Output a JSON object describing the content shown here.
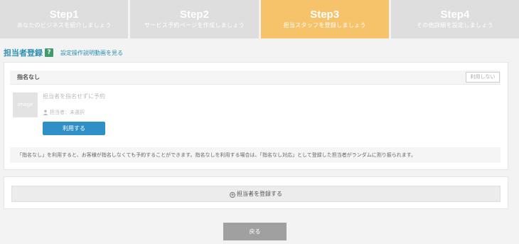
{
  "steps": [
    {
      "title": "Step1",
      "subtitle": "あなたのビジネスを紹介しましょう",
      "active": false
    },
    {
      "title": "Step2",
      "subtitle": "サービス予約ページを作成しましょう",
      "active": false
    },
    {
      "title": "Step3",
      "subtitle": "担当スタッフを登録しましょう",
      "active": true
    },
    {
      "title": "Step4",
      "subtitle": "その他詳細を設定しましょう",
      "active": false
    }
  ],
  "heading": {
    "title": "担当者登録",
    "help_icon": "?",
    "video_link": "設定操作説明動画を見る"
  },
  "no_staff_panel": {
    "title": "指名なし",
    "unused_label": "利用しない",
    "image_placeholder": "image",
    "description": "担当者を指名せずに予約",
    "assignment": "担当者：未選択",
    "use_button": "利用する",
    "note": "「指名なし」を利用すると、お客様が指名しなくても予約することができます。指名なしを利用する場合は、「指名なし対応」として登録した担当者がランダムに割り振られます。"
  },
  "register": {
    "label": "担当者を登録する",
    "icon": "+"
  },
  "back_button": "戻る",
  "colors": {
    "active_step": "#f6c36b",
    "inactive_step": "#dedede",
    "primary": "#2f8fc7",
    "heading": "#2a8fb0",
    "help": "#3d9b6c"
  }
}
